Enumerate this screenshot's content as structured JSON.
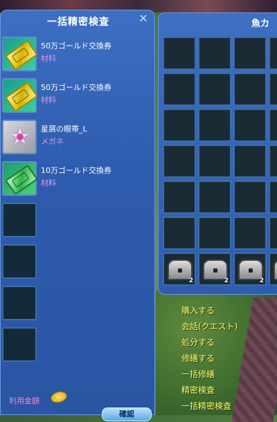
{
  "left_panel": {
    "title": "一括精密検査",
    "close_glyph": "✕",
    "items": [
      {
        "name": "50万ゴールド交換券",
        "type": "材料",
        "icon": "gold-ticket-icon"
      },
      {
        "name": "50万ゴールド交換券",
        "type": "材料",
        "icon": "gold-ticket-icon"
      },
      {
        "name": "星屑の眼帯_L",
        "type": "メガネ",
        "icon": "star-eyepatch-icon"
      },
      {
        "name": "10万ゴールド交換券",
        "type": "材料",
        "icon": "green-ticket-icon"
      }
    ],
    "empty_slot_count": 4,
    "fee_label": "利用金額",
    "confirm_label": "確認"
  },
  "right_panel": {
    "title": "魚カ",
    "grid_rows": 6,
    "chest_row": {
      "count": 4,
      "qty": "2",
      "icon": "treasure-chest-icon"
    }
  },
  "npc_menu": {
    "items": [
      "購入する",
      "会話(クエスト)",
      "処分する",
      "修繕する",
      "一括修繕",
      "精密検査",
      "一括精密検査"
    ]
  },
  "colors": {
    "panel_blue": "#2e5cae",
    "item_type_pink": "#d89ae8",
    "menu_yellow": "#ffff70"
  }
}
